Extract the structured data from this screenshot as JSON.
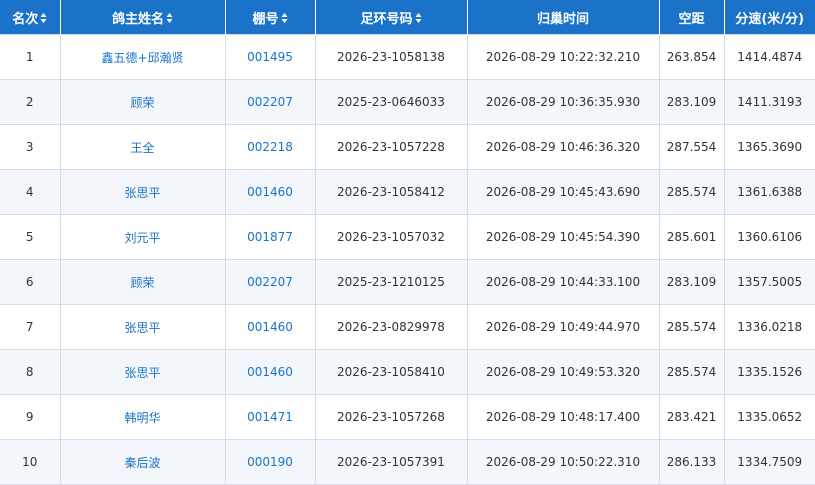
{
  "table": {
    "headers": {
      "rank": "名次",
      "owner": "鸽主姓名",
      "loft": "棚号",
      "ring": "足环号码",
      "arrival": "归巢时间",
      "distance": "空距",
      "speed": "分速(米/分)"
    },
    "rows": [
      {
        "rank": "1",
        "owner": "鑫五德+邱瀚贤",
        "loft": "001495",
        "ring": "2026-23-1058138",
        "arrival": "2026-08-29 10:22:32.210",
        "distance": "263.854",
        "speed": "1414.4874"
      },
      {
        "rank": "2",
        "owner": "顾荣",
        "loft": "002207",
        "ring": "2025-23-0646033",
        "arrival": "2026-08-29 10:36:35.930",
        "distance": "283.109",
        "speed": "1411.3193"
      },
      {
        "rank": "3",
        "owner": "王全",
        "loft": "002218",
        "ring": "2026-23-1057228",
        "arrival": "2026-08-29 10:46:36.320",
        "distance": "287.554",
        "speed": "1365.3690"
      },
      {
        "rank": "4",
        "owner": "张思平",
        "loft": "001460",
        "ring": "2026-23-1058412",
        "arrival": "2026-08-29 10:45:43.690",
        "distance": "285.574",
        "speed": "1361.6388"
      },
      {
        "rank": "5",
        "owner": "刘元平",
        "loft": "001877",
        "ring": "2026-23-1057032",
        "arrival": "2026-08-29 10:45:54.390",
        "distance": "285.601",
        "speed": "1360.6106"
      },
      {
        "rank": "6",
        "owner": "顾荣",
        "loft": "002207",
        "ring": "2025-23-1210125",
        "arrival": "2026-08-29 10:44:33.100",
        "distance": "283.109",
        "speed": "1357.5005"
      },
      {
        "rank": "7",
        "owner": "张思平",
        "loft": "001460",
        "ring": "2026-23-0829978",
        "arrival": "2026-08-29 10:49:44.970",
        "distance": "285.574",
        "speed": "1336.0218"
      },
      {
        "rank": "8",
        "owner": "张思平",
        "loft": "001460",
        "ring": "2026-23-1058410",
        "arrival": "2026-08-29 10:49:53.320",
        "distance": "285.574",
        "speed": "1335.1526"
      },
      {
        "rank": "9",
        "owner": "韩明华",
        "loft": "001471",
        "ring": "2026-23-1057268",
        "arrival": "2026-08-29 10:48:17.400",
        "distance": "283.421",
        "speed": "1335.0652"
      },
      {
        "rank": "10",
        "owner": "秦后波",
        "loft": "000190",
        "ring": "2026-23-1057391",
        "arrival": "2026-08-29 10:50:22.310",
        "distance": "286.133",
        "speed": "1334.7509"
      }
    ]
  },
  "icons": {
    "sort": "sort-icon"
  },
  "colors": {
    "header_bg": "#1a73c8",
    "link": "#1a73c8",
    "row_alt": "#f3f7fc"
  }
}
